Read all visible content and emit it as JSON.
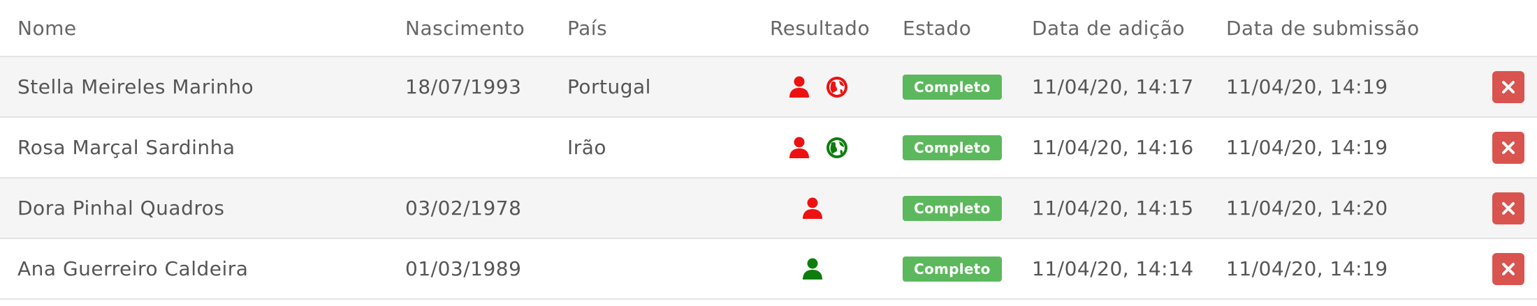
{
  "columns": {
    "name": "Nome",
    "birth": "Nascimento",
    "country": "País",
    "result": "Resultado",
    "state": "Estado",
    "added": "Data de adição",
    "submitted": "Data de submissão"
  },
  "rows": [
    {
      "name": "Stella Meireles Marinho",
      "birth": "18/07/1993",
      "country": "Portugal",
      "result_icons": [
        "person-icon",
        "globe-icon"
      ],
      "result_colors": [
        "#ee1111",
        "#ee1111"
      ],
      "state": "Completo",
      "added": "11/04/20, 14:17",
      "submitted": "11/04/20, 14:19"
    },
    {
      "name": "Rosa Marçal Sardinha",
      "birth": "",
      "country": "Irão",
      "result_icons": [
        "person-icon",
        "globe-icon"
      ],
      "result_colors": [
        "#ee1111",
        "#0e7d0e"
      ],
      "state": "Completo",
      "added": "11/04/20, 14:16",
      "submitted": "11/04/20, 14:19"
    },
    {
      "name": "Dora Pinhal Quadros",
      "birth": "03/02/1978",
      "country": "",
      "result_icons": [
        "person-icon"
      ],
      "result_colors": [
        "#ee1111"
      ],
      "state": "Completo",
      "added": "11/04/20, 14:15",
      "submitted": "11/04/20, 14:20"
    },
    {
      "name": "Ana Guerreiro Caldeira",
      "birth": "01/03/1989",
      "country": "",
      "result_icons": [
        "person-icon"
      ],
      "result_colors": [
        "#0e7d0e"
      ],
      "state": "Completo",
      "added": "11/04/20, 14:14",
      "submitted": "11/04/20, 14:19"
    }
  ],
  "colors": {
    "badge_green": "#5cb85c",
    "delete_red": "#d9534f",
    "negative_red": "#ee1111",
    "positive_green": "#0e7d0e"
  }
}
